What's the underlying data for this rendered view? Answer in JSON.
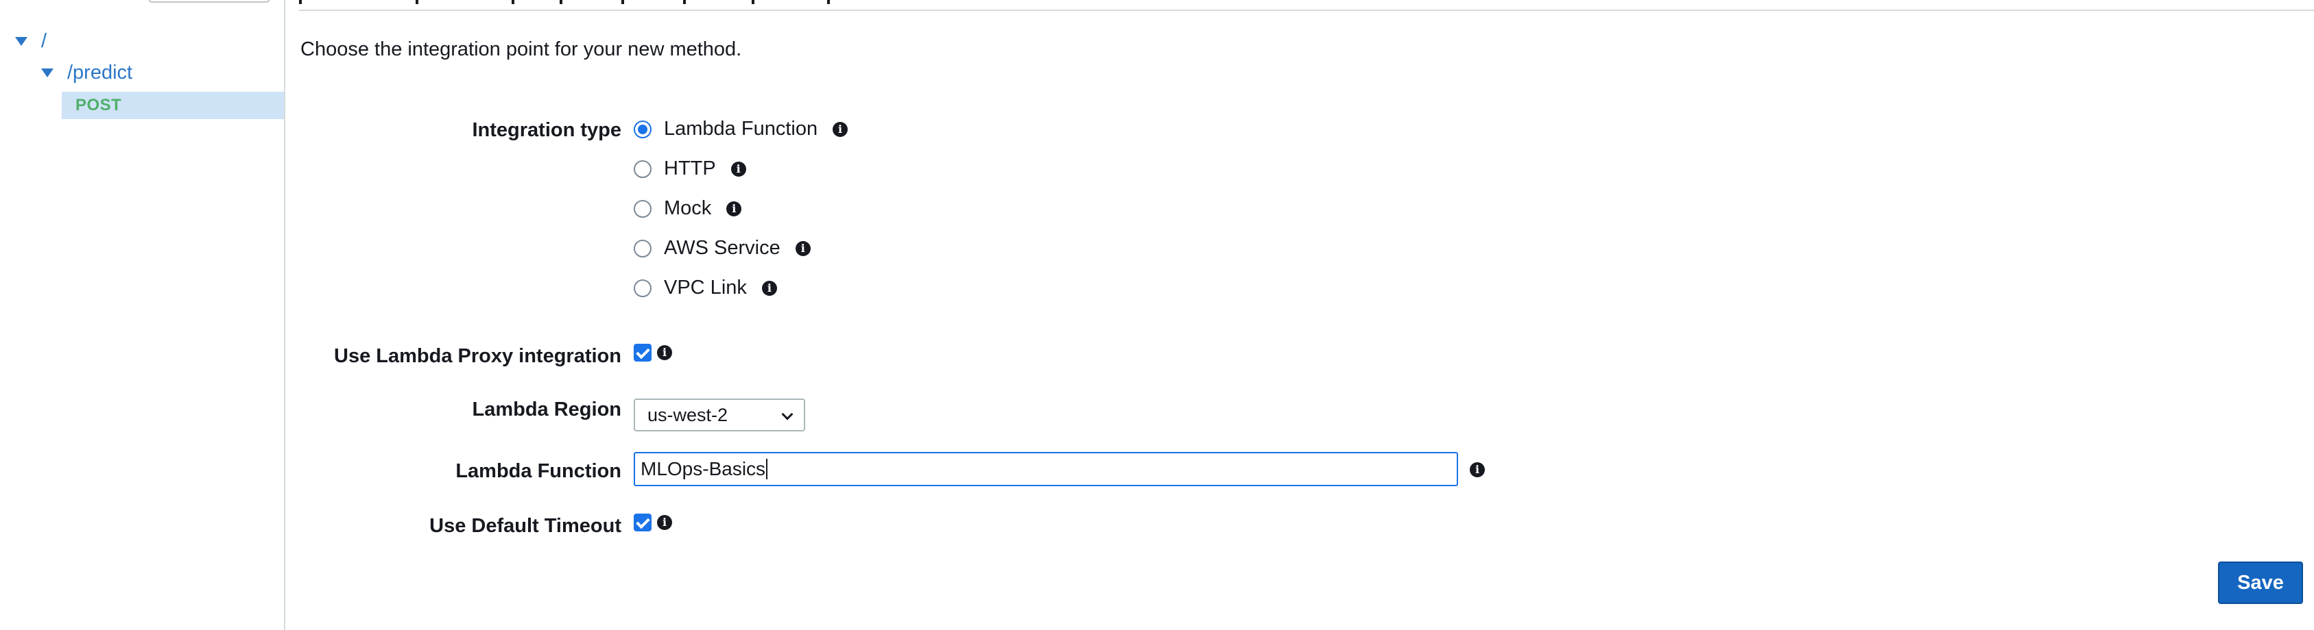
{
  "sidebar": {
    "tree": [
      {
        "label": "/",
        "expanded": true
      },
      {
        "label": "/predict",
        "expanded": true
      }
    ],
    "selected_method": "POST"
  },
  "main": {
    "intro": "Choose the integration point for your new method.",
    "integration_type": {
      "label": "Integration type",
      "options": [
        {
          "label": "Lambda Function",
          "selected": true
        },
        {
          "label": "HTTP",
          "selected": false
        },
        {
          "label": "Mock",
          "selected": false
        },
        {
          "label": "AWS Service",
          "selected": false
        },
        {
          "label": "VPC Link",
          "selected": false
        }
      ]
    },
    "lambda_proxy": {
      "label": "Use Lambda Proxy integration",
      "checked": true
    },
    "lambda_region": {
      "label": "Lambda Region",
      "value": "us-west-2"
    },
    "lambda_function": {
      "label": "Lambda Function",
      "value": "MLOps-Basics"
    },
    "default_timeout": {
      "label": "Use Default Timeout",
      "checked": true
    },
    "save_label": "Save"
  },
  "colors": {
    "link": "#2c76c7",
    "method": "#4fb06a",
    "selected_row": "#cfe3f7",
    "primary": "#1566c0"
  },
  "icons": {
    "info": "info-circle-icon",
    "caret": "caret-down-icon"
  }
}
